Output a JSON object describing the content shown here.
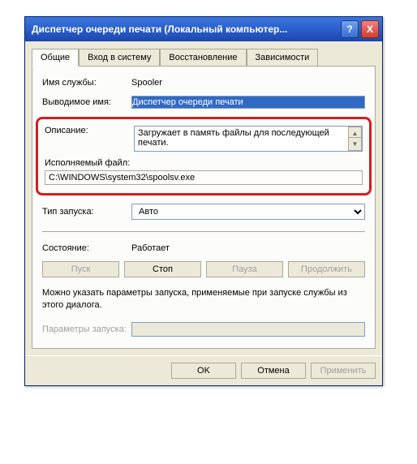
{
  "titlebar": {
    "title": "Диспетчер очереди печати (Локальный компьютер...",
    "help": "?",
    "close": "X"
  },
  "tabs": {
    "general": "Общие",
    "logon": "Вход в систему",
    "recovery": "Восстановление",
    "deps": "Зависимости"
  },
  "labels": {
    "service_name": "Имя службы:",
    "display_name": "Выводимое имя:",
    "description": "Описание:",
    "executable": "Исполняемый файл:",
    "startup_type": "Тип запуска:",
    "status": "Состояние:",
    "start_params": "Параметры запуска:"
  },
  "values": {
    "service_name": "Spooler",
    "display_name": "Диспетчер очереди печати",
    "description": "Загружает в память файлы для последующей печати.",
    "executable": "C:\\WINDOWS\\system32\\spoolsv.exe",
    "startup_type": "Авто",
    "status": "Работает"
  },
  "buttons": {
    "start": "Пуск",
    "stop": "Стоп",
    "pause": "Пауза",
    "resume": "Продолжить",
    "ok": "OK",
    "cancel": "Отмена",
    "apply": "Применить"
  },
  "hint": "Можно указать параметры запуска, применяемые при запуске службы из этого диалога."
}
